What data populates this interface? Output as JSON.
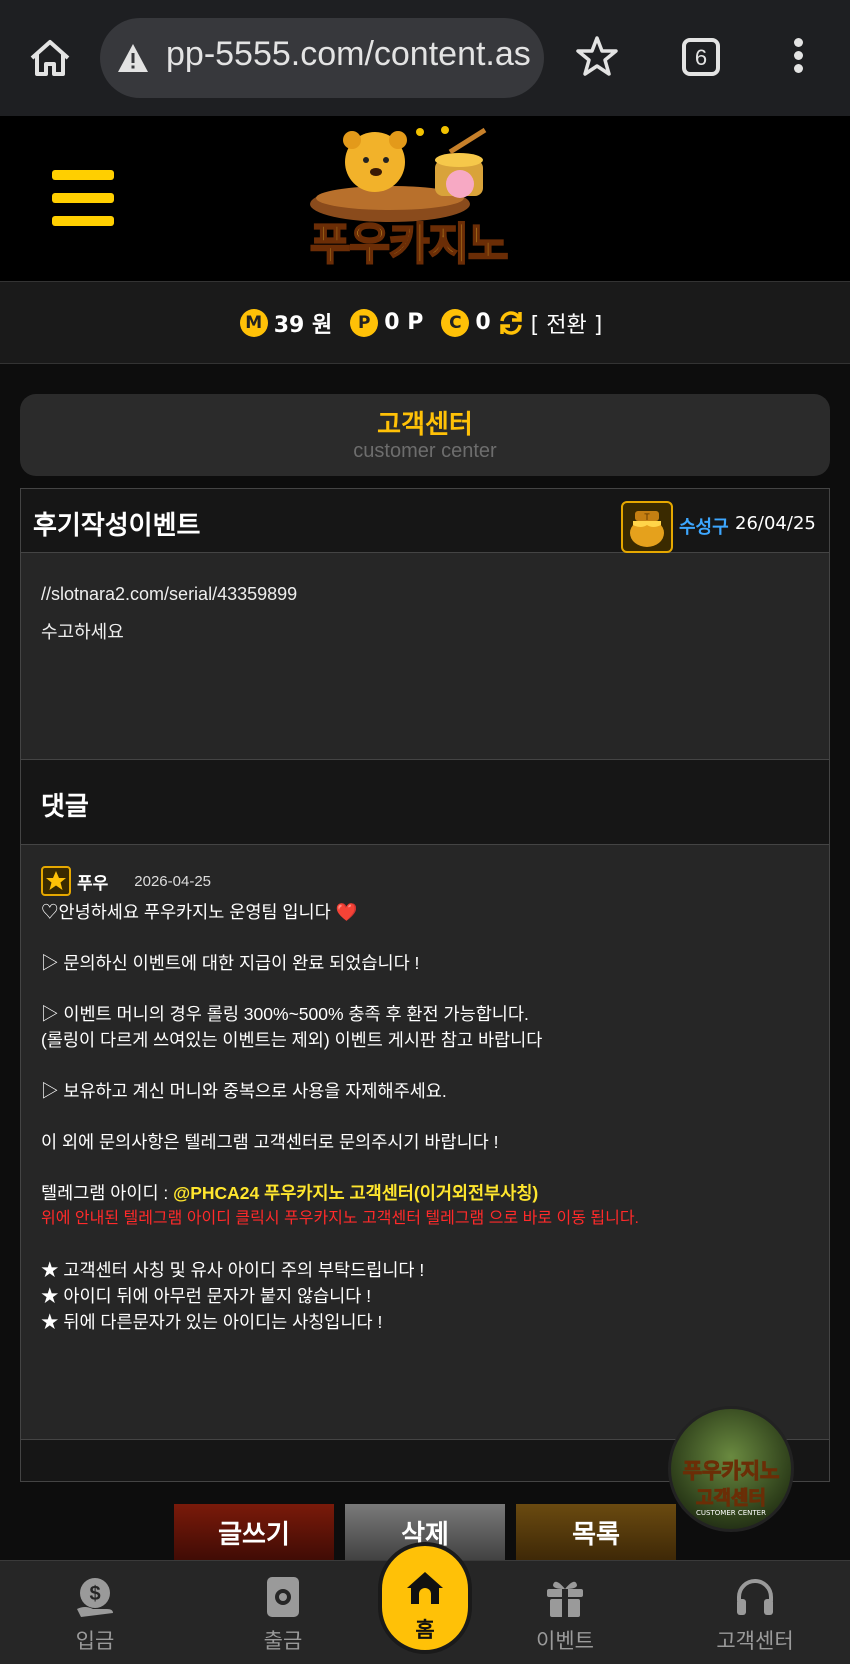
{
  "browser": {
    "url": "pp-5555.com/content.as",
    "tab_count": "6"
  },
  "site": {
    "logo_text": "푸우카지노"
  },
  "points": {
    "money_coin": "M",
    "money_value": "39 원",
    "point_coin": "P",
    "point_value": "0 P",
    "casino_coin": "C",
    "casino_value": "0",
    "convert_label": "[ 전환 ]"
  },
  "section": {
    "title": "고객센터",
    "subtitle": "customer center"
  },
  "post": {
    "title": "후기작성이벤트",
    "author": "수성구",
    "date": "26/04/25",
    "body_lines": [
      "//slotnara2.com/serial/43359899",
      "수고하세요"
    ]
  },
  "comments": {
    "header": "댓글",
    "author": "푸우",
    "date": "2026-04-25",
    "lines": [
      "♡안녕하세요 푸우카지노 운영팀 입니다 ❤️",
      "▷ 문의하신 이벤트에 대한 지급이 완료 되었습니다 !",
      "▷ 이벤트 머니의 경우 롤링 300%~500% 충족 후 환전 가능합니다.",
      "(롤링이 다르게 쓰여있는 이벤트는 제외) 이벤트 게시판 참고 바랍니다",
      "▷ 보유하고 계신 머니와 중복으로 사용을 자제해주세요.",
      "이 외에 문의사항은 텔레그램 고객센터로 문의주시기 바랍니다 !",
      "텔레그램 아이디 : ",
      "@PHCA24 푸우카지노 고객센터(이거외전부사칭)",
      "위에 안내된 텔레그램 아이디 클릭시 푸우카지노 고객센터 텔레그램 으로 바로 이동 됩니다.",
      "★ 고객센터 사칭 및 유사 아이디 주의 부탁드립니다 !",
      "★ 아이디 뒤에 아무런 문자가 붙지 않습니다 !",
      "★ 뒤에 다른문자가 있는 아이디는 사칭입니다 !"
    ]
  },
  "buttons": {
    "write": "글쓰기",
    "delete": "삭제",
    "list": "목록"
  },
  "floating": {
    "line1": "푸우카지노",
    "line2": "고객센터",
    "line3": "CUSTOMER CENTER"
  },
  "nav": {
    "deposit": "입금",
    "withdraw": "출금",
    "home": "홈",
    "event": "이벤트",
    "cs": "고객센터"
  },
  "colors": {
    "accent": "#ffc107",
    "author_blue": "#3da7ff",
    "telegram_yellow": "#ffe62e",
    "warning_red": "#ff2a2a"
  }
}
